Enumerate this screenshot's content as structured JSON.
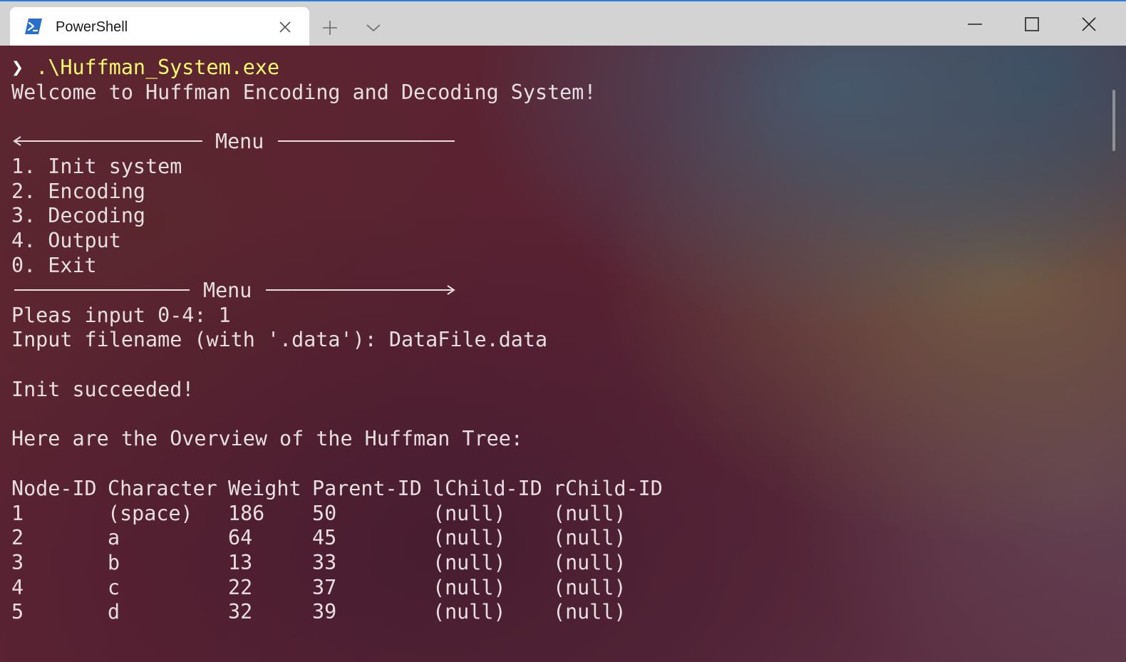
{
  "window": {
    "tab_title": "PowerShell",
    "accent_color": "#2b7bd8",
    "icons": {
      "tab": "powershell-icon",
      "close_tab": "close-icon",
      "new_tab": "plus-icon",
      "dropdown": "chevron-down-icon",
      "minimize": "minimize-icon",
      "maximize": "maximize-icon",
      "close": "close-icon"
    }
  },
  "terminal": {
    "prompt": {
      "symbol": "❯",
      "command": ".\\Huffman_System.exe"
    },
    "welcome": "Welcome to Huffman Encoding and Decoding System!",
    "menu": {
      "top_title": "Menu",
      "bottom_title": "Menu",
      "items": [
        "1. Init system",
        "2. Encoding",
        "3. Decoding",
        "4. Output",
        "0. Exit"
      ]
    },
    "input_choice": "Pleas input 0-4: 1",
    "input_filename": "Input filename (with '.data'): DataFile.data",
    "init_status": "Init succeeded!",
    "overview_heading": "Here are the Overview of the Huffman Tree:",
    "table": {
      "headers": [
        "Node-ID",
        "Character",
        "Weight",
        "Parent-ID",
        "lChild-ID",
        "rChild-ID"
      ],
      "rows": [
        [
          "1",
          "(space)",
          "186",
          "50",
          "(null)",
          "(null)"
        ],
        [
          "2",
          "a",
          "64",
          "45",
          "(null)",
          "(null)"
        ],
        [
          "3",
          "b",
          "13",
          "33",
          "(null)",
          "(null)"
        ],
        [
          "4",
          "c",
          "22",
          "37",
          "(null)",
          "(null)"
        ],
        [
          "5",
          "d",
          "32",
          "39",
          "(null)",
          "(null)"
        ]
      ]
    }
  }
}
